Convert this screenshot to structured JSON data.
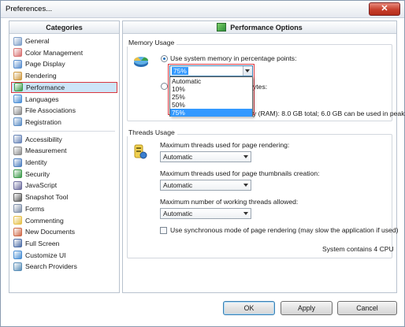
{
  "window": {
    "title": "Preferences..."
  },
  "categories": {
    "header": "Categories",
    "group1": [
      {
        "label": "General",
        "icon": "general-icon",
        "color": "#7f9fc8"
      },
      {
        "label": "Color Management",
        "icon": "color-management-icon",
        "color": "#d87070"
      },
      {
        "label": "Page Display",
        "icon": "page-display-icon",
        "color": "#5a8fcf"
      },
      {
        "label": "Rendering",
        "icon": "rendering-icon",
        "color": "#cf9a42"
      },
      {
        "label": "Performance",
        "icon": "performance-icon",
        "color": "#3a9a46"
      },
      {
        "label": "Languages",
        "icon": "languages-icon",
        "color": "#4c8fd6"
      },
      {
        "label": "File Associations",
        "icon": "file-associations-icon",
        "color": "#8a8a8a"
      },
      {
        "label": "Registration",
        "icon": "registration-icon",
        "color": "#5d8ec5"
      }
    ],
    "group2": [
      {
        "label": "Accessibility",
        "icon": "accessibility-icon",
        "color": "#6a86b8"
      },
      {
        "label": "Measurement",
        "icon": "measurement-icon",
        "color": "#8c8c8c"
      },
      {
        "label": "Identity",
        "icon": "identity-icon",
        "color": "#4f7fbf"
      },
      {
        "label": "Security",
        "icon": "security-icon",
        "color": "#3d9a4b"
      },
      {
        "label": "JavaScript",
        "icon": "javascript-icon",
        "color": "#6d6d9e"
      },
      {
        "label": "Snapshot Tool",
        "icon": "snapshot-tool-icon",
        "color": "#5d5d5d"
      },
      {
        "label": "Forms",
        "icon": "forms-icon",
        "color": "#7f8fa8"
      },
      {
        "label": "Commenting",
        "icon": "commenting-icon",
        "color": "#e6c04a"
      },
      {
        "label": "New Documents",
        "icon": "new-documents-icon",
        "color": "#cf6a4a"
      },
      {
        "label": "Full Screen",
        "icon": "full-screen-icon",
        "color": "#4f6fa8"
      },
      {
        "label": "Customize UI",
        "icon": "customize-ui-icon",
        "color": "#4a8fd4"
      },
      {
        "label": "Search Providers",
        "icon": "search-providers-icon",
        "color": "#5a8fb8"
      }
    ]
  },
  "options": {
    "header": "Performance Options",
    "memory": {
      "title": "Memory Usage",
      "radio1_label": "Use system memory in percentage points:",
      "radio2_label_tail": "ytes:",
      "combo_value": "75%",
      "dropdown_items": [
        "Automatic",
        "10%",
        "25%",
        "50%",
        "75%"
      ],
      "dropdown_selected": "75%",
      "info_text": "y (RAM): 8.0 GB total; 6.0 GB can be used in peak"
    },
    "threads": {
      "title": "Threads Usage",
      "label1": "Maximum threads used for page rendering:",
      "value1": "Automatic",
      "label2": "Maximum threads used for page thumbnails creation:",
      "value2": "Automatic",
      "label3": "Maximum number of working threads allowed:",
      "value3": "Automatic",
      "sync_label": "Use synchronous mode of page rendering (may slow the application if used)",
      "cpu_info": "System contains 4 CPU"
    }
  },
  "buttons": {
    "ok": "OK",
    "apply": "Apply",
    "cancel": "Cancel"
  },
  "colors": {
    "selection": "#cde5f8",
    "highlight_border": "#d9363e",
    "dropdown_selected": "#3399ff"
  }
}
